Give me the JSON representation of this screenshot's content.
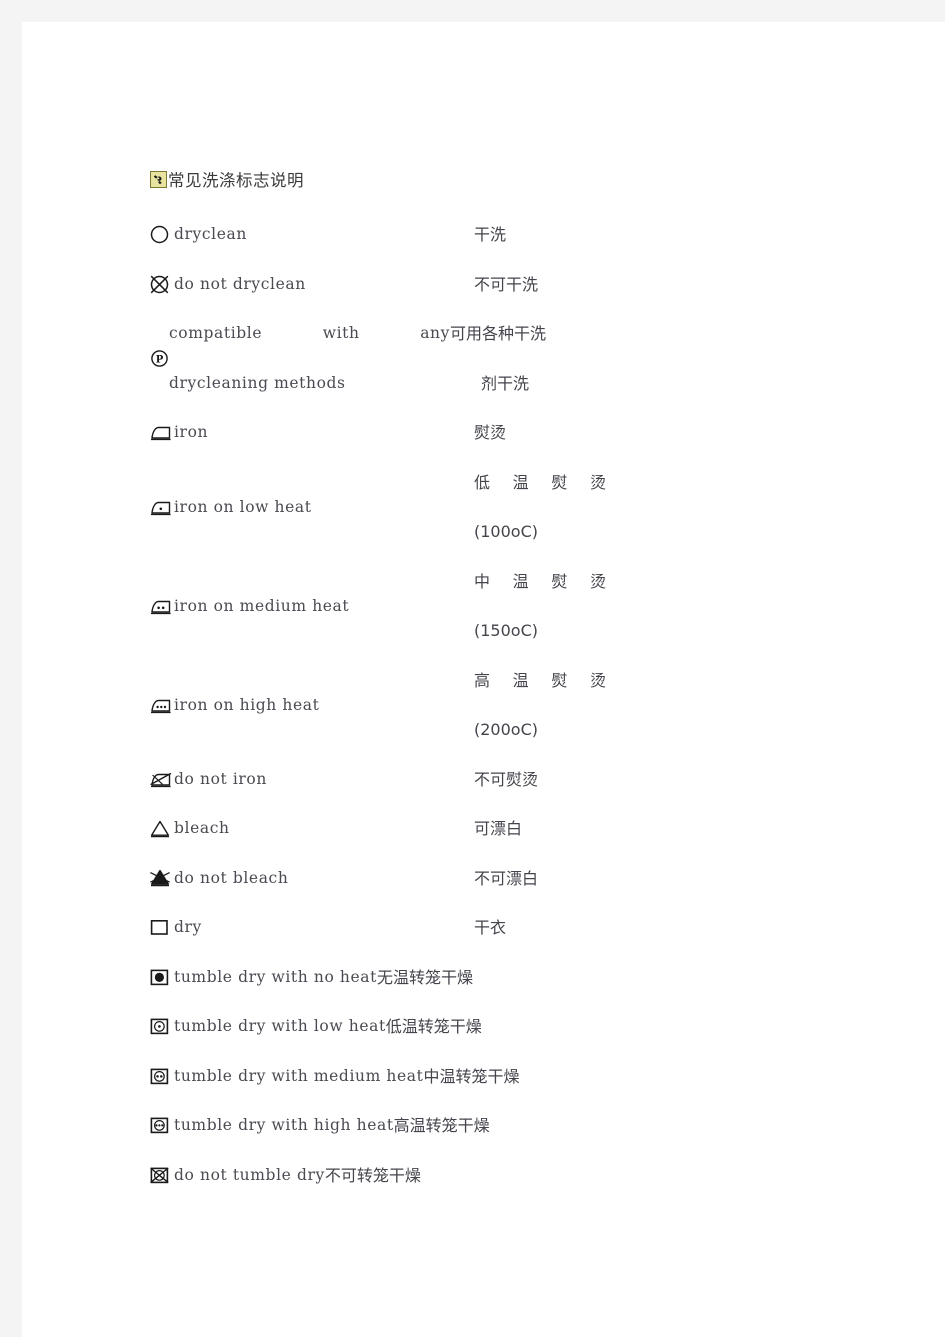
{
  "document": {
    "title_icon": "link-anchor-icon",
    "title": "常见洗涤标志说明"
  },
  "care_symbols": [
    {
      "symbol": "circle-icon",
      "english": "dryclean",
      "chinese": "干洗",
      "layout": "simple"
    },
    {
      "symbol": "circle-crossed-icon",
      "english": "do not dryclean",
      "chinese": "不可干洗",
      "layout": "simple"
    },
    {
      "symbol": "circle-p-icon",
      "english_line1_words": [
        "compatible",
        "with",
        "any"
      ],
      "english_line2": "drycleaning methods",
      "chinese_line1": "可用各种干洗",
      "chinese_line2": "剂干洗",
      "layout": "compat"
    },
    {
      "symbol": "iron-icon",
      "english": "iron",
      "chinese": "熨烫",
      "layout": "simple"
    },
    {
      "symbol": "iron-1dot-icon",
      "english": "iron on low heat",
      "chinese_chars": [
        "低",
        "温",
        "熨",
        "烫"
      ],
      "chinese_line2": "(100oC)",
      "layout": "tall"
    },
    {
      "symbol": "iron-2dot-icon",
      "english": "iron on medium heat",
      "chinese_chars": [
        "中",
        "温",
        "熨",
        "烫"
      ],
      "chinese_line2": "(150oC)",
      "layout": "tall"
    },
    {
      "symbol": "iron-3dot-icon",
      "english": "iron on high heat",
      "chinese_chars": [
        "高",
        "温",
        "熨",
        "烫"
      ],
      "chinese_line2": "(200oC)",
      "layout": "tall"
    },
    {
      "symbol": "iron-crossed-icon",
      "english": "do not iron",
      "chinese": "不可熨烫",
      "layout": "simple"
    },
    {
      "symbol": "triangle-icon",
      "english": "bleach",
      "chinese": "可漂白",
      "layout": "simple"
    },
    {
      "symbol": "triangle-filled-crossed-icon",
      "english": "do not bleach",
      "chinese": "不可漂白",
      "layout": "simple"
    },
    {
      "symbol": "square-icon",
      "english": "dry",
      "chinese": "干衣",
      "layout": "simple"
    },
    {
      "symbol": "tumble-dry-filled-icon",
      "english": "tumble dry with no heat",
      "chinese": "无温转笼干燥",
      "layout": "tumble"
    },
    {
      "symbol": "tumble-dry-1dot-icon",
      "english": "tumble dry with low heat",
      "chinese": "低温转笼干燥",
      "layout": "tumble"
    },
    {
      "symbol": "tumble-dry-2dot-icon",
      "english": "tumble dry with medium heat",
      "chinese": "中温转笼干燥",
      "layout": "tumble"
    },
    {
      "symbol": "tumble-dry-3dot-icon",
      "english": "tumble dry with high heat",
      "chinese": "高温转笼干燥",
      "layout": "tumble"
    },
    {
      "symbol": "tumble-dry-crossed-icon",
      "english": "do not tumble dry",
      "chinese": "不可转笼干燥",
      "layout": "tumble"
    }
  ],
  "colors": {
    "page_background": "#f4f4f4",
    "page": "#ffffff",
    "text": "#44444c",
    "english_text": "#4a4a52",
    "icon_stroke": "#1a1a1a",
    "title_icon_bg": "#e8e4a0"
  }
}
